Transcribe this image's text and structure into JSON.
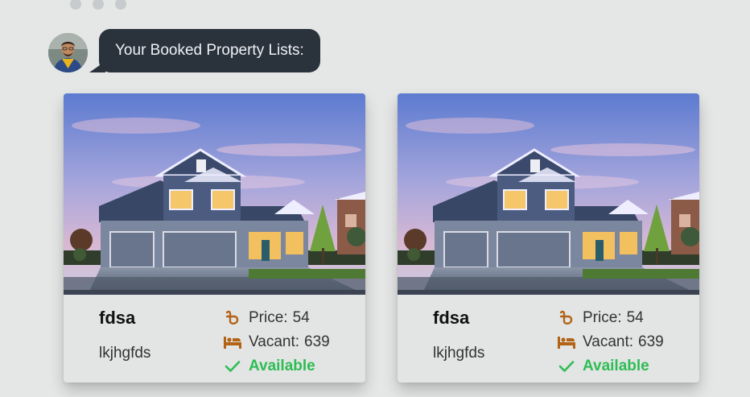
{
  "chat": {
    "message": "Your Booked Property Lists:"
  },
  "colors": {
    "bubble_bg": "#2a323c",
    "icon_brown": "#b26316",
    "available_green": "#2ebd54"
  },
  "cards": [
    {
      "title": "fdsa",
      "description": "lkjhgfds",
      "price_label": "Price:",
      "price": "54",
      "vacant_label": "Vacant:",
      "vacant": "639",
      "status": "Available",
      "icons": [
        "currency-taka-icon",
        "bed-icon",
        "checkmark-icon"
      ]
    },
    {
      "title": "fdsa",
      "description": "lkjhgfds",
      "price_label": "Price:",
      "price": "54",
      "vacant_label": "Vacant:",
      "vacant": "639",
      "status": "Available",
      "icons": [
        "currency-taka-icon",
        "bed-icon",
        "checkmark-icon"
      ]
    }
  ]
}
